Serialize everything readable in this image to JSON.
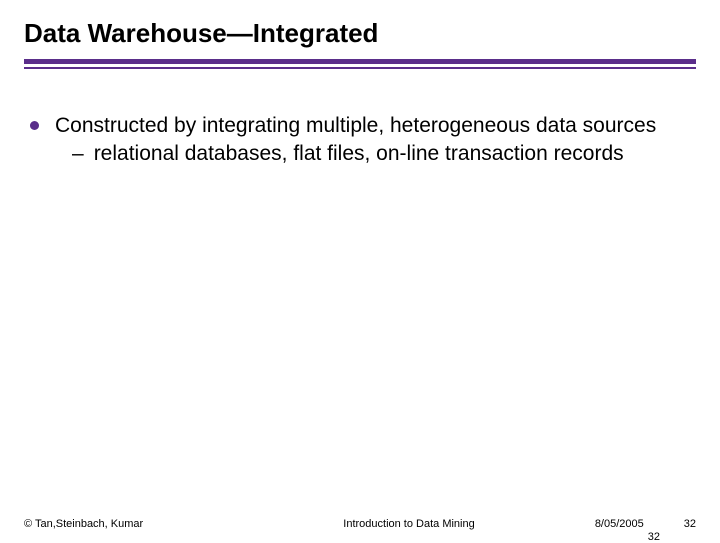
{
  "title": "Data Warehouse—Integrated",
  "bullets": [
    {
      "text": "Constructed by integrating multiple, heterogeneous data sources",
      "sub": [
        "relational databases, flat files, on-line transaction records"
      ]
    }
  ],
  "footer": {
    "left": "© Tan,Steinbach, Kumar",
    "center": "Introduction to Data Mining",
    "date": "8/05/2005",
    "page": "32",
    "page_below": "32"
  }
}
